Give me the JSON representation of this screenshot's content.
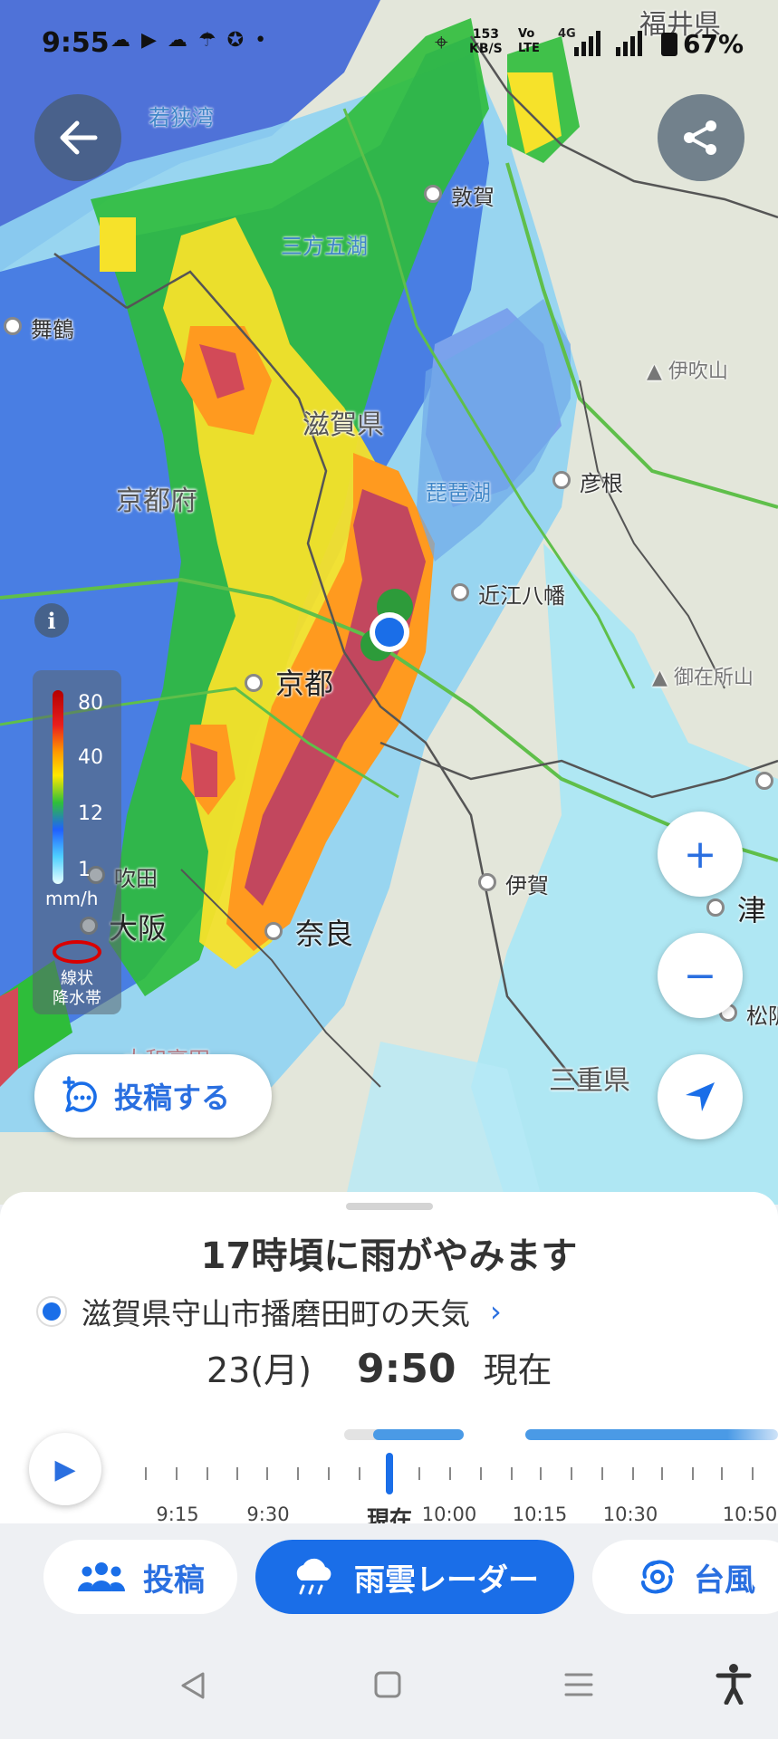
{
  "status_bar": {
    "time": "9:55",
    "speed": [
      "153",
      "KB/S"
    ],
    "network": [
      "Vo",
      "LTE"
    ],
    "signal": "4G",
    "battery": "67%"
  },
  "map": {
    "prefectures": [
      "福井県",
      "滋賀県",
      "京都府",
      "三重県"
    ],
    "cities": [
      "敦賀",
      "舞鶴",
      "彦根",
      "近江八幡",
      "伊賀",
      "吹田",
      "津",
      "松阪"
    ],
    "major_cities": [
      "京都",
      "大阪",
      "奈良"
    ],
    "water": [
      "若狭湾",
      "三方五湖",
      "琵琶湖"
    ],
    "mountains": [
      "伊吹山",
      "御在所山"
    ],
    "faint": "大和高田"
  },
  "legend": {
    "levels": [
      "80",
      "40",
      "12",
      "1"
    ],
    "unit": "mm/h",
    "line_label": [
      "線状",
      "降水帯"
    ]
  },
  "post_button": {
    "label": "投稿する"
  },
  "sheet": {
    "headline": "17時頃に雨がやみます",
    "location": "滋賀県守山市播磨田町の天気",
    "date": "23(月)",
    "time": "9:50",
    "now": "現在"
  },
  "timeline": {
    "labels": [
      "9:15",
      "9:30",
      "現在",
      "10:00",
      "10:15",
      "10:30",
      "10:50"
    ],
    "current_label": "現在"
  },
  "tabs": [
    {
      "label": "投稿",
      "active": false
    },
    {
      "label": "雨雲レーダー",
      "active": true
    },
    {
      "label": "台風",
      "active": false
    }
  ],
  "colors": {
    "accent": "#1a6ee8",
    "rain_heavy": "#b84a5f",
    "rain_mid": "#ffe800",
    "rain_light": "#2fbf3a"
  }
}
